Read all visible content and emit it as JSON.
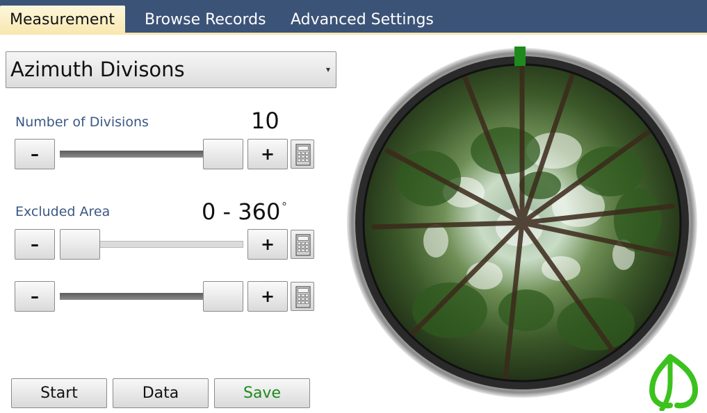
{
  "tabs": [
    {
      "label": "Measurement",
      "active": true
    },
    {
      "label": "Browse Records",
      "active": false
    },
    {
      "label": "Advanced Settings",
      "active": false
    }
  ],
  "mode_select": {
    "value": "Azimuth Divisons"
  },
  "divisions": {
    "label": "Number of Divisions",
    "value": "10",
    "slider_fraction": 1.0,
    "minus_label": "–",
    "plus_label": "+"
  },
  "excluded_area": {
    "label": "Excluded Area",
    "value": "0 - 360",
    "unit": "°",
    "start_fraction": 0.0,
    "end_fraction": 1.0,
    "minus_label": "–",
    "plus_label": "+"
  },
  "buttons": {
    "start": "Start",
    "data": "Data",
    "save": "Save"
  },
  "colors": {
    "tab_bar": "#3c5378",
    "active_tab": "#f8e7ae",
    "label_blue": "#3a5784",
    "save_green": "#1e8a1e",
    "north_marker": "#1e8a1e",
    "logo_green": "#3cc21e"
  },
  "icons": [
    "calculator-icon",
    "leaf-logo-icon",
    "north-marker"
  ]
}
